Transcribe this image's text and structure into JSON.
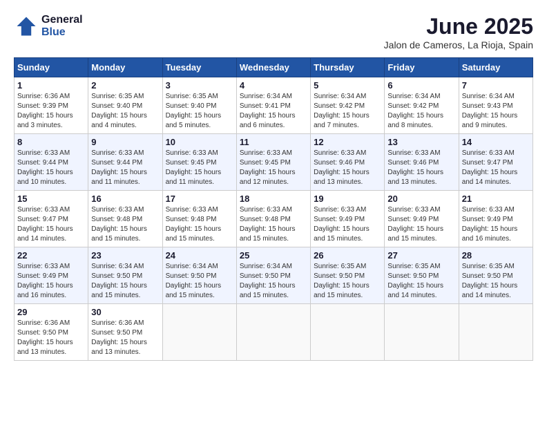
{
  "header": {
    "logo_line1": "General",
    "logo_line2": "Blue",
    "month_title": "June 2025",
    "location": "Jalon de Cameros, La Rioja, Spain"
  },
  "days_of_week": [
    "Sunday",
    "Monday",
    "Tuesday",
    "Wednesday",
    "Thursday",
    "Friday",
    "Saturday"
  ],
  "weeks": [
    [
      {
        "day": "1",
        "sunrise": "6:36 AM",
        "sunset": "9:39 PM",
        "daylight": "15 hours and 3 minutes."
      },
      {
        "day": "2",
        "sunrise": "6:35 AM",
        "sunset": "9:40 PM",
        "daylight": "15 hours and 4 minutes."
      },
      {
        "day": "3",
        "sunrise": "6:35 AM",
        "sunset": "9:40 PM",
        "daylight": "15 hours and 5 minutes."
      },
      {
        "day": "4",
        "sunrise": "6:34 AM",
        "sunset": "9:41 PM",
        "daylight": "15 hours and 6 minutes."
      },
      {
        "day": "5",
        "sunrise": "6:34 AM",
        "sunset": "9:42 PM",
        "daylight": "15 hours and 7 minutes."
      },
      {
        "day": "6",
        "sunrise": "6:34 AM",
        "sunset": "9:42 PM",
        "daylight": "15 hours and 8 minutes."
      },
      {
        "day": "7",
        "sunrise": "6:34 AM",
        "sunset": "9:43 PM",
        "daylight": "15 hours and 9 minutes."
      }
    ],
    [
      {
        "day": "8",
        "sunrise": "6:33 AM",
        "sunset": "9:44 PM",
        "daylight": "15 hours and 10 minutes."
      },
      {
        "day": "9",
        "sunrise": "6:33 AM",
        "sunset": "9:44 PM",
        "daylight": "15 hours and 11 minutes."
      },
      {
        "day": "10",
        "sunrise": "6:33 AM",
        "sunset": "9:45 PM",
        "daylight": "15 hours and 11 minutes."
      },
      {
        "day": "11",
        "sunrise": "6:33 AM",
        "sunset": "9:45 PM",
        "daylight": "15 hours and 12 minutes."
      },
      {
        "day": "12",
        "sunrise": "6:33 AM",
        "sunset": "9:46 PM",
        "daylight": "15 hours and 13 minutes."
      },
      {
        "day": "13",
        "sunrise": "6:33 AM",
        "sunset": "9:46 PM",
        "daylight": "15 hours and 13 minutes."
      },
      {
        "day": "14",
        "sunrise": "6:33 AM",
        "sunset": "9:47 PM",
        "daylight": "15 hours and 14 minutes."
      }
    ],
    [
      {
        "day": "15",
        "sunrise": "6:33 AM",
        "sunset": "9:47 PM",
        "daylight": "15 hours and 14 minutes."
      },
      {
        "day": "16",
        "sunrise": "6:33 AM",
        "sunset": "9:48 PM",
        "daylight": "15 hours and 15 minutes."
      },
      {
        "day": "17",
        "sunrise": "6:33 AM",
        "sunset": "9:48 PM",
        "daylight": "15 hours and 15 minutes."
      },
      {
        "day": "18",
        "sunrise": "6:33 AM",
        "sunset": "9:48 PM",
        "daylight": "15 hours and 15 minutes."
      },
      {
        "day": "19",
        "sunrise": "6:33 AM",
        "sunset": "9:49 PM",
        "daylight": "15 hours and 15 minutes."
      },
      {
        "day": "20",
        "sunrise": "6:33 AM",
        "sunset": "9:49 PM",
        "daylight": "15 hours and 15 minutes."
      },
      {
        "day": "21",
        "sunrise": "6:33 AM",
        "sunset": "9:49 PM",
        "daylight": "15 hours and 16 minutes."
      }
    ],
    [
      {
        "day": "22",
        "sunrise": "6:33 AM",
        "sunset": "9:49 PM",
        "daylight": "15 hours and 16 minutes."
      },
      {
        "day": "23",
        "sunrise": "6:34 AM",
        "sunset": "9:50 PM",
        "daylight": "15 hours and 15 minutes."
      },
      {
        "day": "24",
        "sunrise": "6:34 AM",
        "sunset": "9:50 PM",
        "daylight": "15 hours and 15 minutes."
      },
      {
        "day": "25",
        "sunrise": "6:34 AM",
        "sunset": "9:50 PM",
        "daylight": "15 hours and 15 minutes."
      },
      {
        "day": "26",
        "sunrise": "6:35 AM",
        "sunset": "9:50 PM",
        "daylight": "15 hours and 15 minutes."
      },
      {
        "day": "27",
        "sunrise": "6:35 AM",
        "sunset": "9:50 PM",
        "daylight": "15 hours and 14 minutes."
      },
      {
        "day": "28",
        "sunrise": "6:35 AM",
        "sunset": "9:50 PM",
        "daylight": "15 hours and 14 minutes."
      }
    ],
    [
      {
        "day": "29",
        "sunrise": "6:36 AM",
        "sunset": "9:50 PM",
        "daylight": "15 hours and 13 minutes."
      },
      {
        "day": "30",
        "sunrise": "6:36 AM",
        "sunset": "9:50 PM",
        "daylight": "15 hours and 13 minutes."
      },
      null,
      null,
      null,
      null,
      null
    ]
  ],
  "labels": {
    "sunrise": "Sunrise: ",
    "sunset": "Sunset: ",
    "daylight": "Daylight: "
  }
}
